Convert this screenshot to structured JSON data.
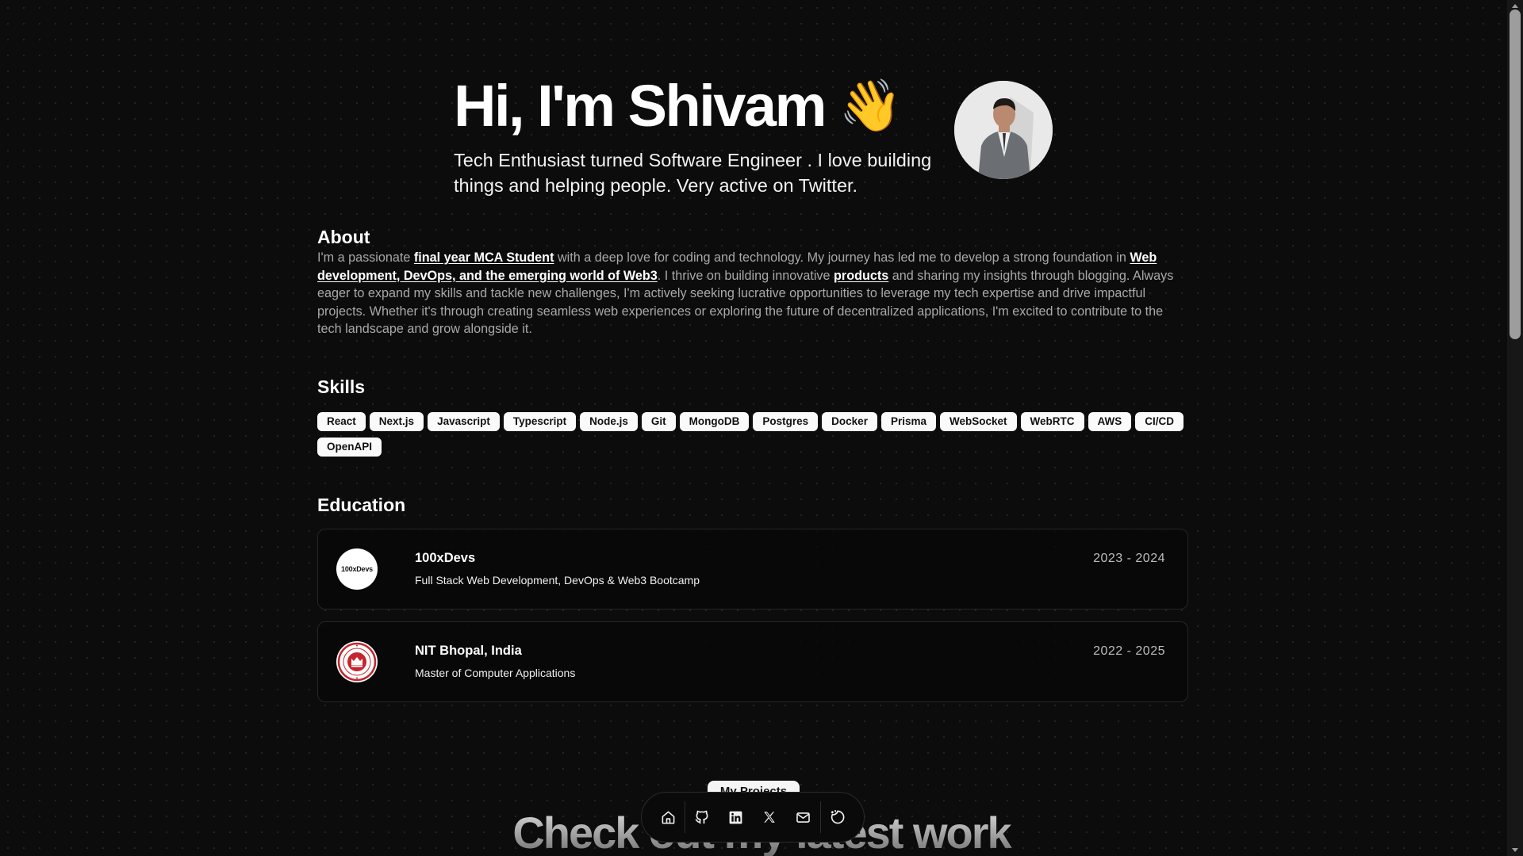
{
  "hero": {
    "title": "Hi, I'm Shivam",
    "wave_emoji": "👋",
    "subtitle": "Tech Enthusiast turned Software Engineer . I love building things and helping people. Very active on Twitter.",
    "avatar_icon": "profile-photo"
  },
  "about": {
    "title": "About",
    "text_1": "I'm a passionate ",
    "link_1": "final year MCA Student",
    "text_2": " with a deep love for coding and technology. My journey has led me to develop a strong foundation in ",
    "link_2": "Web development, DevOps, and the emerging world of Web3",
    "text_3": ". I thrive on building innovative ",
    "link_3": "products",
    "text_4": " and sharing my insights through blogging. Always eager to expand my skills and tackle new challenges, I'm actively seeking lucrative opportunities to leverage my tech expertise and drive impactful projects. Whether it's through creating seamless web experiences or exploring the future of decentralized applications, I'm excited to contribute to the tech landscape and grow alongside it."
  },
  "skills": {
    "title": "Skills",
    "items": [
      "React",
      "Next.js",
      "Javascript",
      "Typescript",
      "Node.js",
      "Git",
      "MongoDB",
      "Postgres",
      "Docker",
      "Prisma",
      "WebSocket",
      "WebRTC",
      "AWS",
      "CI/CD",
      "OpenAPI"
    ]
  },
  "education": {
    "title": "Education",
    "items": [
      {
        "name": "100xDevs",
        "logo_text": "100xDevs",
        "description": "Full Stack Web Development, DevOps & Web3 Bootcamp",
        "dates": "2023 - 2024"
      },
      {
        "name": "NIT Bhopal, India",
        "logo_text": "",
        "description": "Master of Computer Applications",
        "dates": "2022 - 2025"
      }
    ]
  },
  "projects": {
    "pill_label": "My Projects",
    "heading": "Check out my latest work"
  },
  "dock": {
    "items": [
      "home-icon",
      "github-icon",
      "linkedin-icon",
      "x-twitter-icon",
      "mail-icon",
      "theme-toggle-icon"
    ]
  },
  "colors": {
    "background": "#0c0c0c",
    "text_primary": "#ffffff",
    "text_muted": "#a8a8a8",
    "chip_bg": "#fafafa",
    "card_border": "#262626",
    "seal_red": "#c4262e"
  }
}
